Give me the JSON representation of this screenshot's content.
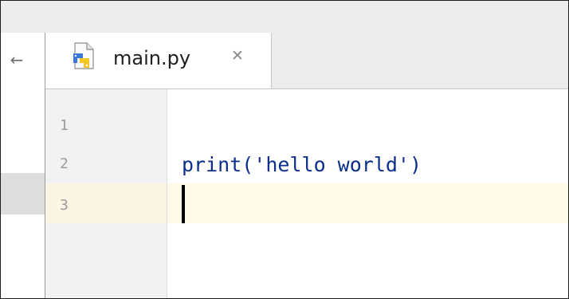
{
  "colors": {
    "background": "#ffffff",
    "tab_bar": "#ececec",
    "gutter": "#f2f2f2",
    "current_line": "#fffae8",
    "code_text": "#0b2f8a",
    "line_number": "#9a9a9a"
  },
  "left_panel": {
    "back_icon": "left-arrow-icon",
    "back_glyph": "←"
  },
  "tab": {
    "icon": "python-file-icon",
    "label": "main.py",
    "close_icon": "close-icon",
    "close_glyph": "✕"
  },
  "editor": {
    "line_numbers": [
      "1",
      "2",
      "3"
    ],
    "lines": [
      "",
      "print('hello world')",
      ""
    ],
    "caret_line": "3"
  }
}
